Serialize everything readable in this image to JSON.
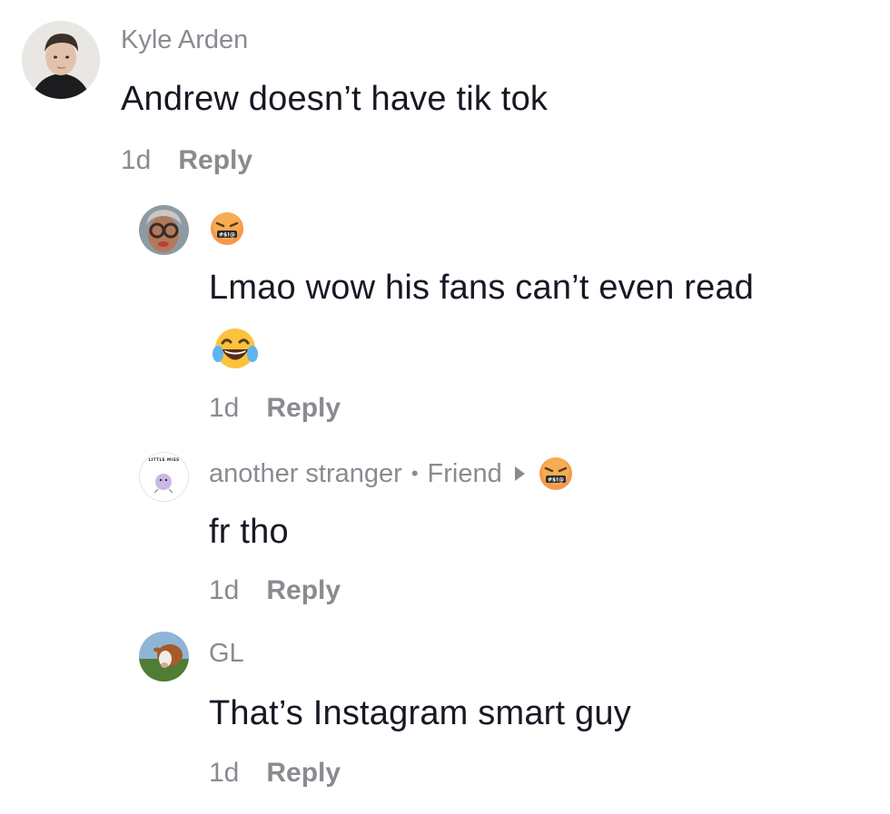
{
  "comments": [
    {
      "username": "Kyle Arden",
      "text": "Andrew doesn’t have tik tok",
      "time": "1d",
      "reply_label": "Reply"
    },
    {
      "username": "",
      "username_emoji": "angry-censored-emoji",
      "text": "Lmao wow his fans can’t even read",
      "text_emoji": "laughing-crying-emoji",
      "time": "1d",
      "reply_label": "Reply"
    },
    {
      "username": "another stranger",
      "relation": "Friend",
      "separator": "•",
      "username_emoji": "angry-censored-emoji",
      "avatar_text": "LITTLE MISS",
      "text": "fr tho",
      "time": "1d",
      "reply_label": "Reply"
    },
    {
      "username": "GL",
      "text": "That’s Instagram smart guy",
      "time": "1d",
      "reply_label": "Reply"
    }
  ]
}
